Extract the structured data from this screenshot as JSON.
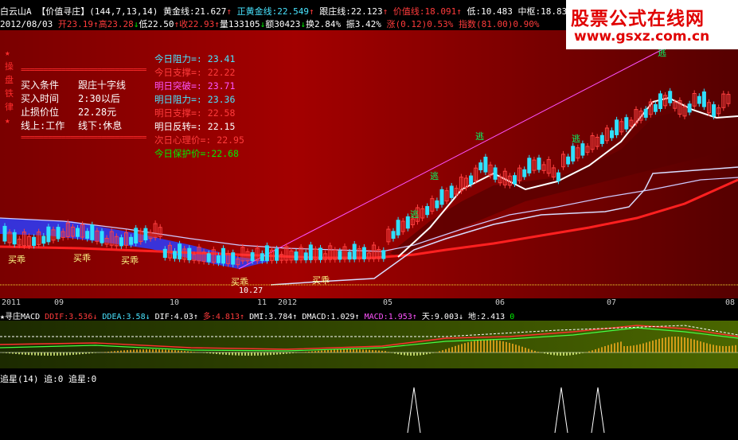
{
  "colors": {
    "up": "#ff3b3b",
    "down": "#00ee00",
    "chart_bg": "#8b0000",
    "brand": "#e00000"
  },
  "watermark": {
    "line1": "股票公式在线网",
    "line2": "www.gsxz.com.cn"
  },
  "header1": {
    "stock": "白云山A",
    "indicator": "【价值寻庄】",
    "params": "(144,7,13,14)",
    "items": [
      {
        "label": "黄金线:",
        "value": "21.627",
        "arrow": "↑"
      },
      {
        "label": "正黄金线:",
        "value": "22.549",
        "arrow": "↑"
      },
      {
        "label": "跟庄线:",
        "value": "22.123",
        "arrow": "↑"
      },
      {
        "label": "价值线:",
        "value": "18.091",
        "arrow": "↑"
      },
      {
        "label": "低:",
        "value": "10.483"
      },
      {
        "label": "中枢:",
        "value": "18.83"
      }
    ]
  },
  "header2": {
    "date": "2012/08/03",
    "open": "开23.19",
    "high": "高23.28",
    "low": "低22.50",
    "close": "收22.93",
    "vol": "量133105",
    "amt": "额30423",
    "turn": "换2.84%",
    "amp": "振3.42%",
    "chg": "涨(0.12)0.53%",
    "idx": "指数(81.00)0.90%"
  },
  "side_text": [
    "★",
    "操",
    "盘",
    "铁",
    "律",
    "★"
  ],
  "strategy": {
    "dash": "============================",
    "rows": [
      [
        "买入条件",
        "跟庄十字线"
      ],
      [
        "买入时间",
        "2:30以后"
      ],
      [
        "止损价位",
        "22.28元"
      ],
      [
        "线上:工作",
        "线下:休息"
      ]
    ]
  },
  "levels": [
    {
      "text": "今日阻力=: 23.41",
      "color": "c"
    },
    {
      "text": "今日支撑=: 22.22",
      "color": "r"
    },
    {
      "text": "明日突破=: 23.71",
      "color": "m"
    },
    {
      "text": "明日阻力=: 23.36",
      "color": "c"
    },
    {
      "text": "明日支撑=: 22.58",
      "color": "r"
    },
    {
      "text": "明日反转=: 22.15",
      "color": "w"
    },
    {
      "text": "次日心理价=: 22.95",
      "color": "r"
    },
    {
      "text": "今日保护价=:22.68",
      "color": "g"
    }
  ],
  "chart_labels": {
    "buy": "买乖",
    "escape": "逃",
    "low_price": "10.27"
  },
  "axis": [
    "2011",
    "09",
    "10",
    "11",
    "2012",
    "05",
    "06",
    "07",
    "08"
  ],
  "macd": {
    "title": "★寻庄MACD",
    "items": [
      {
        "t": "DDIF:3.536↓",
        "c": "r"
      },
      {
        "t": "DDEA:3.58↓",
        "c": "c"
      },
      {
        "t": "DIF:4.03↑",
        "c": "w"
      },
      {
        "t": "多:4.813↑",
        "c": "r"
      },
      {
        "t": "DMI:3.784↑",
        "c": "w"
      },
      {
        "t": "DMACD:1.029↑",
        "c": "w"
      },
      {
        "t": "MACD:1.953↑",
        "c": "m"
      },
      {
        "t": "天:9.003↓",
        "c": "w"
      },
      {
        "t": "地:2.413",
        "c": "w"
      },
      {
        "t": "0",
        "c": "g"
      }
    ]
  },
  "star": {
    "title": "追星(14)",
    "a": "追:0",
    "b": "追星:0"
  }
}
